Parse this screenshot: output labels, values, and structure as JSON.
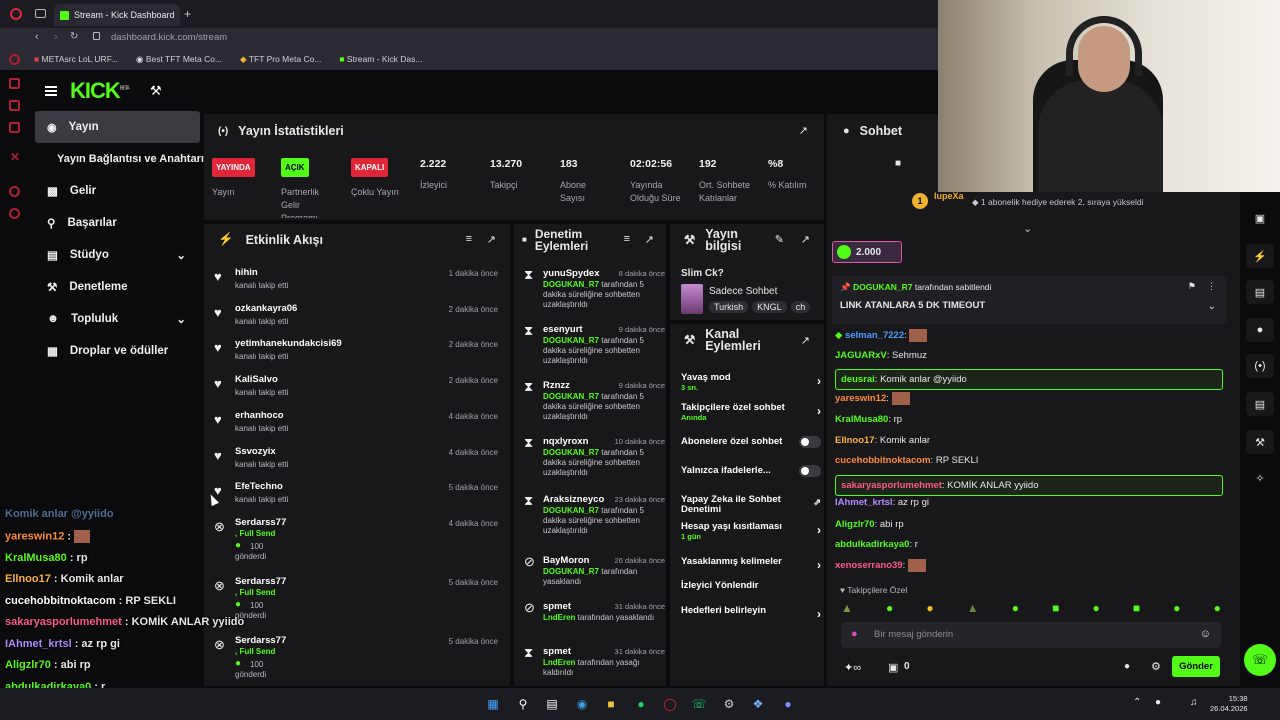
{
  "browser": {
    "tab_title": "Stream - Kick Dashboard",
    "new_tab": "+",
    "url_host": "dashboard.kick.com",
    "url_path": "/stream",
    "bookmarks": [
      "METAsrc LoL URF...",
      "Best TFT Meta Co...",
      "TFT Pro Meta Co...",
      "Stream - Kick Das..."
    ]
  },
  "brand": {
    "logo": "KICK",
    "beta": "BETA"
  },
  "sidebar": {
    "items": [
      {
        "label": "Yayın",
        "icon": "broadcast-icon",
        "active": true
      },
      {
        "label": "Yayın Bağlantısı ve Anahtarı",
        "icon": "",
        "active": false
      },
      {
        "label": "Gelir",
        "icon": "chart-icon",
        "active": false
      },
      {
        "label": "Başarılar",
        "icon": "trophy-icon",
        "active": false
      },
      {
        "label": "Stüdyo",
        "icon": "studio-icon",
        "active": false,
        "chevron": true
      },
      {
        "label": "Denetleme",
        "icon": "wrench-icon",
        "active": false
      },
      {
        "label": "Topluluk",
        "icon": "community-icon",
        "active": false,
        "chevron": true
      },
      {
        "label": "Droplar ve ödüller",
        "icon": "gift-icon",
        "active": false
      }
    ]
  },
  "stats": {
    "title": "Yayın İstatistikleri",
    "cells": [
      {
        "badge": "YAYINDA",
        "badge_color": "#e0273a",
        "label": "Yayın"
      },
      {
        "badge": "AÇIK",
        "badge_color": "#53fc18",
        "label": "Partnerlik Gelir Programı"
      },
      {
        "badge": "KAPALI",
        "badge_color": "#e0273a",
        "label": "Çoklu Yayın"
      },
      {
        "value": "2.222",
        "label": "İzleyici"
      },
      {
        "value": "13.270",
        "label": "Takipçi"
      },
      {
        "value": "183",
        "label": "Abone Sayısı"
      },
      {
        "value": "02:02:56",
        "label": "Yayında Olduğu Süre"
      },
      {
        "value": "192",
        "label": "Ort. Sohbete Katılanlar"
      },
      {
        "value": "%8",
        "label": "% Katılım"
      }
    ]
  },
  "activity": {
    "title": "Etkinlik Akışı",
    "items": [
      {
        "name": "hihin",
        "sub": "kanalı takip etti",
        "time": "1 dakika önce"
      },
      {
        "name": "ozkankayra06",
        "sub": "kanalı takip etti",
        "time": "2 dakika önce"
      },
      {
        "name": "yetimhanekundakcisi69",
        "sub": "kanalı takip etti",
        "time": "2 dakika önce"
      },
      {
        "name": "KaliSalvo",
        "sub": "kanalı takip etti",
        "time": "2 dakika önce"
      },
      {
        "name": "erhanhoco",
        "sub": "kanalı takip etti",
        "time": "4 dakika önce"
      },
      {
        "name": "Ssvozyix",
        "sub": "kanalı takip etti",
        "time": "4 dakika önce"
      },
      {
        "name": "EfeTechno",
        "sub": "kanalı takip etti",
        "time": "5 dakika önce"
      }
    ],
    "subs": [
      {
        "name": "Serdarss77",
        "tier": ", Full Send",
        "amount": "100",
        "sub": "gönderdi",
        "time": "4 dakika önce"
      },
      {
        "name": "Serdarss77",
        "tier": ", Full Send",
        "amount": "100",
        "sub": "gönderdi",
        "time": "5 dakika önce"
      },
      {
        "name": "Serdarss77",
        "tier": ", Full Send",
        "amount": "100",
        "sub": "gönderdi",
        "time": "5 dakika önce"
      }
    ]
  },
  "moderation": {
    "title": "Denetim Eylemleri",
    "items": [
      {
        "name": "yunuSpydex",
        "time": "8 dakika önce",
        "mod": "DOGUKAN_R7",
        "text": "tarafından 5 dakika süreliğine sohbetten uzaklaştırıldı"
      },
      {
        "name": "esenyurt",
        "time": "9 dakika önce",
        "mod": "DOGUKAN_R7",
        "text": "tarafından 5 dakika süreliğine sohbetten uzaklaştırıldı"
      },
      {
        "name": "Rznzz",
        "time": "9 dakika önce",
        "mod": "DOGUKAN_R7",
        "text": "tarafından 5 dakika süreliğine sohbetten uzaklaştırıldı"
      },
      {
        "name": "nqxlyroxn",
        "time": "10 dakika önce",
        "mod": "DOGUKAN_R7",
        "text": "tarafından 5 dakika süreliğine sohbetten uzaklaştırıldı"
      },
      {
        "name": "Araksizneyco",
        "time": "23 dakika önce",
        "mod": "DOGUKAN_R7",
        "text": "tarafından 5 dakika süreliğine sohbetten uzaklaştırıldı"
      },
      {
        "name": "BayMoron",
        "time": "26 dakika önce",
        "mod": "DOGUKAN_R7",
        "text": "tarafından yasaklandı"
      },
      {
        "name": "spmet",
        "time": "31 dakika önce",
        "mod": "LndEren",
        "text": "tarafından yasaklandı"
      },
      {
        "name": "spmet",
        "time": "31 dakika önce",
        "mod": "LndEren",
        "text": "tarafından yasağı kaldırıldı"
      }
    ]
  },
  "info": {
    "title": "Yayın bilgisi",
    "stream_title": "Slim Ck?",
    "category": "Sadece Sohbet",
    "tags": [
      "Turkish",
      "KNGL",
      "ch"
    ]
  },
  "channel_actions": {
    "title": "Kanal Eylemleri",
    "items": [
      {
        "label": "Yavaş mod",
        "sub": "3 sn.",
        "kind": "arrow"
      },
      {
        "label": "Takipçilere özel sohbet",
        "sub": "Anında",
        "kind": "arrow"
      },
      {
        "label": "Abonelere özel sohbet",
        "sub": "",
        "kind": "toggle"
      },
      {
        "label": "Yalnızca ifadelerle...",
        "sub": "",
        "kind": "toggle"
      },
      {
        "label": "Yapay Zeka ile Sohbet Denetimi",
        "sub": "",
        "kind": "ext"
      },
      {
        "label": "Hesap yaşı kısıtlaması",
        "sub": "1 gün",
        "kind": "arrow"
      },
      {
        "label": "Yasaklanmış kelimeler",
        "sub": "",
        "kind": "arrow"
      },
      {
        "label": "İzleyici Yönlendir",
        "sub": "",
        "kind": "none"
      },
      {
        "label": "Hedefleri belirleyin",
        "sub": "",
        "kind": "arrow"
      }
    ]
  },
  "chat": {
    "title": "Sohbet",
    "gift_user": "lupeXa",
    "gift_count": "1",
    "gift_text": "1 abonelik hediye ederek 2. sıraya yükseldi",
    "kicks_amount": "2.000",
    "pinned_by": "DOGUKAN_R7",
    "pinned_by_suffix": "tarafından sabitlendi",
    "pinned_text": "LINK ATANLARA 5 DK TIMEOUT",
    "messages": [
      {
        "user": "selman_7222",
        "color": "#4d9cff",
        "text": "",
        "hl": false
      },
      {
        "user": "JAGUARxV",
        "color": "#53fc18",
        "text": "Sehmuz",
        "hl": false
      },
      {
        "user": "deusrai",
        "color": "#53fc18",
        "text": "Komik anlar @yyiido",
        "hl": true
      },
      {
        "user": "yareswin12",
        "color": "#ff8c3a",
        "text": "",
        "hl": false
      },
      {
        "user": "KralMusa80",
        "color": "#53fc18",
        "text": "rp",
        "hl": false
      },
      {
        "user": "Ellnoo17",
        "color": "#ffb340",
        "text": "Komik anlar",
        "hl": false
      },
      {
        "user": "cucehobbitnoktacom",
        "color": "#ff8c3a",
        "text": "RP SEKLI",
        "hl": false
      },
      {
        "user": "sakaryasporlumehmet",
        "color": "#ff5a8a",
        "text": "KOMİK ANLAR yyiido",
        "hl": true
      },
      {
        "user": "IAhmet_krtsl",
        "color": "#b18cff",
        "text": "az rp gi",
        "hl": false
      },
      {
        "user": "Aligzlr70",
        "color": "#53fc18",
        "text": "abi rp",
        "hl": false
      },
      {
        "user": "abdulkadirkaya0",
        "color": "#53fc18",
        "text": "r",
        "hl": false
      },
      {
        "user": "xenoserrano39",
        "color": "#ff5a8a",
        "text": "",
        "hl": false
      }
    ],
    "followers_only": "Takipçilere Özel",
    "input_placeholder": "Bir mesaj gönderin",
    "count": "0",
    "send": "Gönder"
  },
  "overlay_chat": [
    {
      "user": "yareswin12",
      "color": "#ff8c3a",
      "text": ""
    },
    {
      "user": "KralMusa80",
      "color": "#53fc18",
      "text": "rp"
    },
    {
      "user": "Ellnoo17",
      "color": "#ffb340",
      "text": "Komik anlar"
    },
    {
      "user": "cucehobbitnoktacom",
      "color": "#ffffff",
      "text": "RP SEKLI"
    },
    {
      "user": "sakaryasporlumehmet",
      "color": "#ff5a8a",
      "text": "KOMİK ANLAR yyiido"
    },
    {
      "user": "IAhmet_krtsl",
      "color": "#b18cff",
      "text": "az rp gi"
    },
    {
      "user": "Aligzlr70",
      "color": "#53fc18",
      "text": "abi rp"
    },
    {
      "user": "abdulkadirkaya0",
      "color": "#53fc18",
      "text": "r"
    },
    {
      "user": "xenoserrano39",
      "color": "#ffffff",
      "text": ""
    }
  ],
  "overlay_partial": "Komik anlar @yyiido",
  "taskbar": {
    "time": "15:38",
    "date": "26.04.2026"
  },
  "colors": {
    "kick_green": "#53fc18",
    "live_red": "#e0273a",
    "panel": "#18181b"
  }
}
